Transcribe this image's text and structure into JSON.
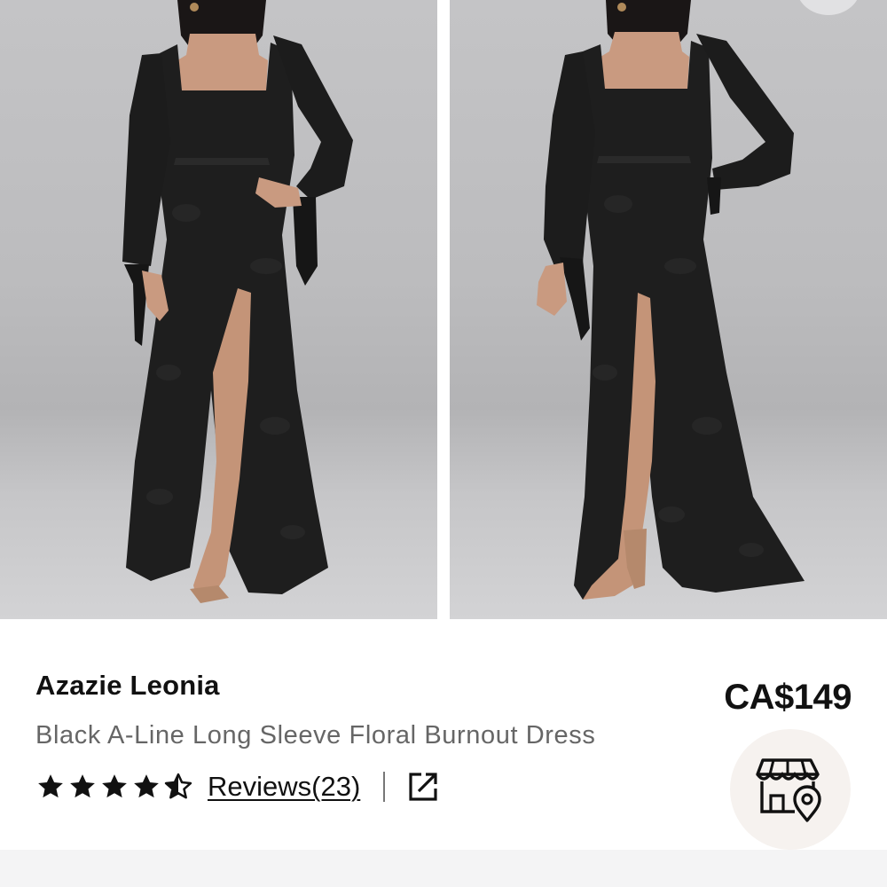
{
  "product": {
    "brand_name": "Azazie Leonia",
    "description": "Black A-Line Long Sleeve Floral Burnout Dress",
    "price": "CA$149"
  },
  "rating": {
    "value": 4.5,
    "max": 5,
    "reviews_label": "Reviews(23)"
  },
  "icons": {
    "star": "star-icon",
    "share": "share-external-icon",
    "store": "store-location-icon"
  },
  "colors": {
    "text_primary": "#111111",
    "text_secondary": "#666666",
    "store_button_bg": "#f6f2ef",
    "dress": "#1e1e1e"
  }
}
